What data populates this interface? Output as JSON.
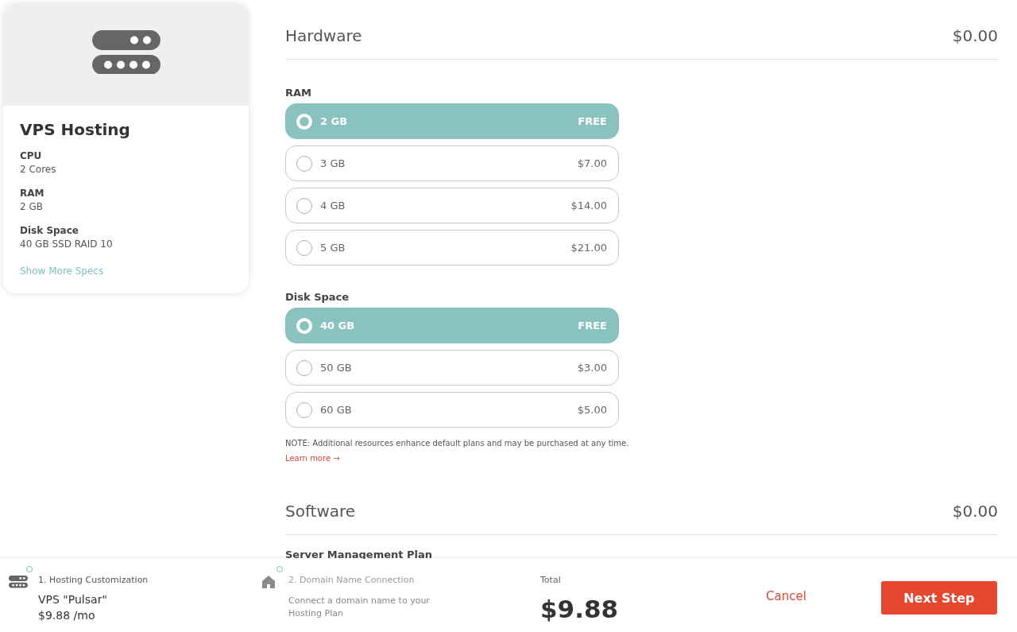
{
  "plan_card": {
    "title": "VPS Hosting",
    "specs": [
      {
        "label": "CPU",
        "value": "2 Cores"
      },
      {
        "label": "RAM",
        "value": "2 GB"
      },
      {
        "label": "Disk Space",
        "value": "40 GB SSD RAID 10"
      }
    ],
    "link": "Show More Specs"
  },
  "sections": [
    {
      "title": "Hardware",
      "price": "$0.00",
      "groups": [
        {
          "label": "RAM",
          "options": [
            {
              "label": "2 GB",
              "price": "FREE",
              "selected": true
            },
            {
              "label": "3 GB",
              "price": "$7.00",
              "selected": false
            },
            {
              "label": "4 GB",
              "price": "$14.00",
              "selected": false
            },
            {
              "label": "5 GB",
              "price": "$21.00",
              "selected": false
            }
          ]
        },
        {
          "label": "Disk Space",
          "options": [
            {
              "label": "40 GB",
              "price": "FREE",
              "selected": true
            },
            {
              "label": "50 GB",
              "price": "$3.00",
              "selected": false
            },
            {
              "label": "60 GB",
              "price": "$5.00",
              "selected": false
            }
          ]
        }
      ],
      "note": "NOTE: Additional resources enhance default plans and may be purchased at any time.",
      "note_link": "Learn more →"
    },
    {
      "title": "Software",
      "price": "$0.00",
      "groups": [
        {
          "label": "Server Management Plan"
        }
      ]
    }
  ],
  "footer": {
    "steps": [
      {
        "kind": "server",
        "title": "1. Hosting Customization",
        "name": "VPS \"Pulsar\"",
        "price": "$9.88 /mo"
      },
      {
        "kind": "home",
        "title": "2. Domain Name Connection",
        "description": "Connect a domain name to your Hosting Plan"
      }
    ],
    "total_label": "Total",
    "total": "$9.88",
    "cancel": "Cancel",
    "next": "Next Step"
  }
}
